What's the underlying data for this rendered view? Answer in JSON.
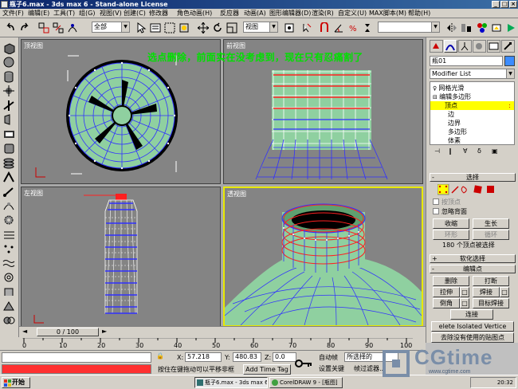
{
  "window": {
    "title": "瓶子6.max - 3ds max 6 - Stand-alone License",
    "controls": [
      "_",
      "□",
      "×"
    ]
  },
  "menu": [
    "文件(F)",
    "编辑(E)",
    "工具(T)",
    "组(G)",
    "视图(V)",
    "创建(C)",
    "修改器",
    "角色动画(H)",
    "反应器",
    "动画(A)",
    "图形编辑器(D)",
    "渲染(R)",
    "自定义(U)",
    "MAX脚本(M)",
    "帮助(H)"
  ],
  "toolbar": {
    "selection_filter": "全部",
    "reference_coord": "视图",
    "named_selection": ""
  },
  "annotation": "选点删除，前面实在没考虑到，现在只有忍痛割了",
  "viewports": {
    "top": "顶视图",
    "front": "前视图",
    "left": "左视图",
    "perspective": "透视图"
  },
  "command_panel": {
    "object_name": "瓶01",
    "modifier_list": "Modifier List",
    "stack": [
      {
        "label": "网格光滑",
        "indent": 0,
        "selected": false
      },
      {
        "label": "编辑多边形",
        "indent": 0,
        "selected": false
      },
      {
        "label": "顶点",
        "indent": 1,
        "selected": true
      },
      {
        "label": "边",
        "indent": 1,
        "selected": false
      },
      {
        "label": "边界",
        "indent": 1,
        "selected": false
      },
      {
        "label": "多边形",
        "indent": 1,
        "selected": false
      },
      {
        "label": "体素",
        "indent": 1,
        "selected": false
      }
    ],
    "rollout_select": "选择",
    "by_vertex": "按顶点",
    "ignore_backfacing": "忽略背面",
    "shrink": "收缩",
    "grow": "生长",
    "ring": "环形",
    "loop": "循环",
    "selection_info": "180 个顶点被选择",
    "rollout_soft": "软化选择",
    "rollout_edit_vertices": "编辑点",
    "remove": "删除",
    "break": "打断",
    "extrude": "拉伸",
    "weld": "焊接",
    "chamfer": "倒角",
    "target_weld": "目标焊接",
    "connect": "连接",
    "remove_isolated": "elete Isolated Vertice",
    "remove_unused_map": "去除没有使用的贴图点"
  },
  "timeline": {
    "slider_label": "0 / 100",
    "ticks": [
      "0",
      "10",
      "20",
      "30",
      "40",
      "50",
      "60",
      "70",
      "80",
      "90",
      "100"
    ]
  },
  "status": {
    "x_label": "X:",
    "x_value": "57.218",
    "y_label": "Y:",
    "y_value": "480.83",
    "z_label": "Z:",
    "z_value": "0.0",
    "prompt": "按住在键拖动可以平移非框",
    "add_time_tag": "Add Time Tag",
    "auto_key": "自动帧",
    "set_key": "设置关键",
    "selected": "所选择的",
    "key_filters": "帧过滤器..."
  },
  "taskbar": {
    "start": "开始",
    "tasks": [
      "瓶子6.max - 3ds max 6 -...",
      "CorelDRAW 9 - [瓶图]"
    ],
    "clock": "20:32"
  },
  "logo": {
    "text": "CGtime",
    "url": "www.cgtime.com"
  },
  "colors": {
    "bottle_green": "#8fd0a0",
    "selected_vertex": "#ff2020",
    "wire_blue": "#3030ff",
    "annotation_green": "#00e000",
    "active_viewport": "#e8e800"
  }
}
